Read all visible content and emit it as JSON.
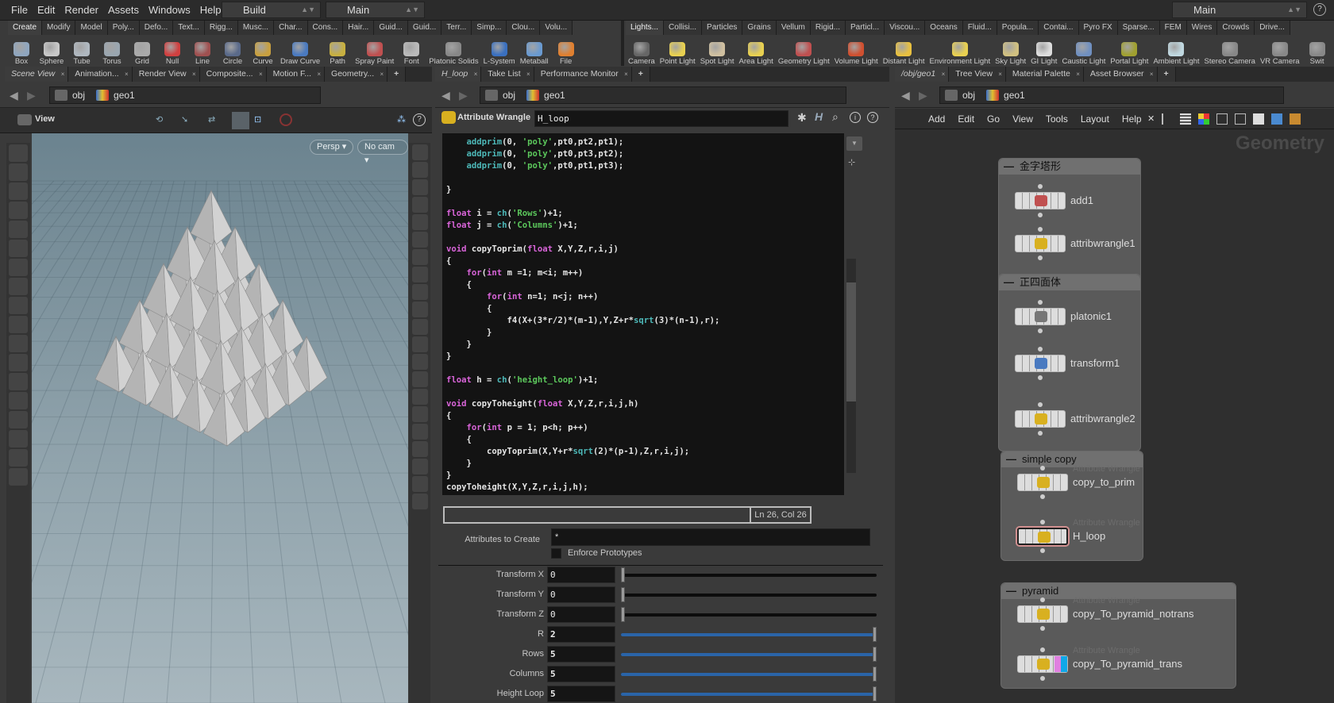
{
  "menubar": {
    "items": [
      "File",
      "Edit",
      "Render",
      "Assets",
      "Windows",
      "Help"
    ],
    "desktop": "Build",
    "context": "Main",
    "right_desktop": "Main"
  },
  "shelf": {
    "left_tabs": [
      "Create",
      "Modify",
      "Model",
      "Poly...",
      "Defo...",
      "Text...",
      "Rigg...",
      "Musc...",
      "Char...",
      "Cons...",
      "Hair...",
      "Guid...",
      "Guid...",
      "Terr...",
      "Simp...",
      "Clou...",
      "Volu..."
    ],
    "right_tabs": [
      "Lights...",
      "Collisi...",
      "Particles",
      "Grains",
      "Vellum",
      "Rigid...",
      "Particl...",
      "Viscou...",
      "Oceans",
      "Fluid...",
      "Popula...",
      "Contai...",
      "Pyro FX",
      "Sparse...",
      "FEM",
      "Wires",
      "Crowds",
      "Drive..."
    ],
    "left_tools": [
      {
        "label": "Box",
        "color": "#8fa6bf"
      },
      {
        "label": "Sphere",
        "color": "#c8c8c8"
      },
      {
        "label": "Tube",
        "color": "#b0b8c0"
      },
      {
        "label": "Torus",
        "color": "#9aa6b0"
      },
      {
        "label": "Grid",
        "color": "#aaaaaa"
      },
      {
        "label": "Null",
        "color": "#d04040"
      },
      {
        "label": "Line",
        "color": "#a05050"
      },
      {
        "label": "Circle",
        "color": "#5a6a8a"
      },
      {
        "label": "Curve",
        "color": "#c8a040"
      },
      {
        "label": "Draw Curve",
        "color": "#4a7ac0"
      },
      {
        "label": "Path",
        "color": "#c8b040"
      },
      {
        "label": "Spray Paint",
        "color": "#c05050"
      },
      {
        "label": "Font",
        "color": "#bbbbbb"
      },
      {
        "label": "Platonic Solids",
        "color": "#888888"
      },
      {
        "label": "L-System",
        "color": "#3a70c0"
      },
      {
        "label": "Metaball",
        "color": "#6a9ad0"
      },
      {
        "label": "File",
        "color": "#e08030"
      }
    ],
    "right_tools": [
      {
        "label": "Camera",
        "color": "#666666"
      },
      {
        "label": "Point Light",
        "color": "#e8d050"
      },
      {
        "label": "Spot Light",
        "color": "#d0c0a0"
      },
      {
        "label": "Area Light",
        "color": "#e8d050"
      },
      {
        "label": "Geometry Light",
        "color": "#c05050"
      },
      {
        "label": "Volume Light",
        "color": "#d05030"
      },
      {
        "label": "Distant Light",
        "color": "#e8c040"
      },
      {
        "label": "Environment Light",
        "color": "#e8d050"
      },
      {
        "label": "Sky Light",
        "color": "#d0c080"
      },
      {
        "label": "GI Light",
        "color": "#dddddd"
      },
      {
        "label": "Caustic Light",
        "color": "#7090c0"
      },
      {
        "label": "Portal Light",
        "color": "#a0a030"
      },
      {
        "label": "Ambient Light",
        "color": "#c0d8e0"
      },
      {
        "label": "Stereo Camera",
        "color": "#888888"
      },
      {
        "label": "VR Camera",
        "color": "#888888"
      },
      {
        "label": "Swit",
        "color": "#888888"
      }
    ]
  },
  "left_pane": {
    "tabs": [
      "Scene View",
      "Animation...",
      "Render View",
      "Composite...",
      "Motion F...",
      "Geometry..."
    ],
    "path": [
      "obj",
      "geo1"
    ],
    "view_label": "View",
    "persp": "Persp",
    "camera": "No cam"
  },
  "middle_pane": {
    "tabs": [
      "H_loop",
      "Take List",
      "Performance Monitor"
    ],
    "path": [
      "obj",
      "geo1"
    ]
  },
  "right_pane": {
    "tabs": [
      "/obj/geo1",
      "Tree View",
      "Material Palette",
      "Asset Browser"
    ],
    "path": [
      "obj",
      "geo1"
    ]
  },
  "wrangle": {
    "type": "Attribute Wrangle",
    "name": "H_loop",
    "code": [
      "    addprim(0, 'poly',pt0,pt2,pt1);",
      "    addprim(0, 'poly',pt0,pt3,pt2);",
      "    addprim(0, 'poly',pt0,pt1,pt3);",
      "",
      "}",
      "",
      "float i = ch('Rows')+1;",
      "float j = ch('Columns')+1;",
      "",
      "void copyToprim(float X,Y,Z,r,i,j)",
      "{",
      "    for(int m =1; m<i; m++)",
      "    {",
      "        for(int n=1; n<j; n++)",
      "        {",
      "            f4(X+(3*r/2)*(m-1),Y,Z+r*sqrt(3)*(n-1),r);",
      "        }",
      "    }",
      "}",
      "",
      "float h = ch('height_loop')+1;",
      "",
      "void copyToheight(float X,Y,Z,r,i,j,h)",
      "{",
      "    for(int p = 1; p<h; p++)",
      "    {",
      "        copyToprim(X,Y+r*sqrt(2)*(p-1),Z,r,i,j);",
      "    }",
      "}",
      "copyToheight(X,Y,Z,r,i,j,h);"
    ],
    "status": "Ln 26, Col 26",
    "attributes_label": "Attributes to Create",
    "attributes_value": "*",
    "enforce_label": "Enforce Prototypes",
    "params": [
      {
        "label": "Transform X",
        "value": "0",
        "fill": 0
      },
      {
        "label": "Transform Y",
        "value": "0",
        "fill": 0
      },
      {
        "label": "Transform Z",
        "value": "0",
        "fill": 0
      },
      {
        "label": "R",
        "value": "2",
        "fill": 1
      },
      {
        "label": "Rows",
        "value": "5",
        "fill": 1
      },
      {
        "label": "Columns",
        "value": "5",
        "fill": 1
      },
      {
        "label": "Height Loop",
        "value": "5",
        "fill": 1
      }
    ]
  },
  "network": {
    "menu": [
      "Add",
      "Edit",
      "Go",
      "View",
      "Tools",
      "Layout",
      "Help"
    ],
    "watermark": "Geometry",
    "boxes": [
      {
        "title": "金字塔形",
        "nodes": [
          {
            "name": "add1",
            "type": "",
            "icon": "#c05050"
          },
          {
            "name": "attribwrangle1",
            "type": "",
            "icon": "#d8b020"
          }
        ]
      },
      {
        "title": "正四面体",
        "nodes": [
          {
            "name": "platonic1",
            "type": "",
            "icon": "#777777"
          },
          {
            "name": "transform1",
            "type": "",
            "icon": "#4a7ac0"
          },
          {
            "name": "attribwrangle2",
            "type": "",
            "icon": "#d8b020"
          }
        ]
      },
      {
        "title": "simple copy",
        "nodes": [
          {
            "name": "copy_to_prim",
            "type": "Attribute Wrangle",
            "icon": "#d8b020"
          },
          {
            "name": "H_loop",
            "type": "Attribute Wrangle",
            "icon": "#d8b020"
          }
        ]
      },
      {
        "title": "pyramid",
        "nodes": [
          {
            "name": "copy_To_pyramid_notrans",
            "type": "Attribute Wrangle",
            "icon": "#d8b020"
          },
          {
            "name": "copy_To_pyramid_trans",
            "type": "Attribute Wrangle",
            "icon": "#d8b020"
          }
        ]
      }
    ]
  }
}
